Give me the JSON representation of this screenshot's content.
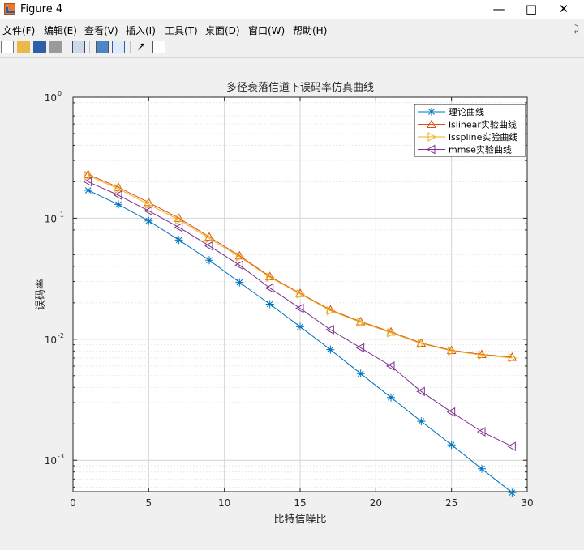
{
  "window": {
    "title": "Figure 4",
    "minimize_icon": "minimize-icon",
    "maximize_icon": "maximize-icon",
    "close_icon": "close-icon"
  },
  "menu": [
    {
      "label": "文件(F)"
    },
    {
      "label": "编辑(E)"
    },
    {
      "label": "查看(V)"
    },
    {
      "label": "插入(I)"
    },
    {
      "label": "工具(T)"
    },
    {
      "label": "桌面(D)"
    },
    {
      "label": "窗口(W)"
    },
    {
      "label": "帮助(H)"
    }
  ],
  "toolbar": {
    "icons": [
      "new-figure-icon",
      "open-file-icon",
      "save-icon",
      "print-icon",
      "link-plot-icon",
      "colorbar-icon",
      "legend-icon",
      "pointer-icon",
      "property-inspector-icon"
    ]
  },
  "chart_data": {
    "type": "line",
    "title": "多径衰落信道下误码率仿真曲线",
    "xlabel": "比特信噪比",
    "ylabel": "误码率",
    "xlim": [
      0,
      30
    ],
    "ylim": [
      0.00055,
      1
    ],
    "yscale": "log",
    "grid": true,
    "legend_position": "top-right",
    "x_ticks": [
      "0",
      "5",
      "10",
      "15",
      "20",
      "25",
      "30"
    ],
    "y_ticks": [
      {
        "base": "10",
        "exp": "0"
      },
      {
        "base": "10",
        "exp": "-1"
      },
      {
        "base": "10",
        "exp": "-2"
      },
      {
        "base": "10",
        "exp": "-3"
      }
    ],
    "x": [
      1,
      3,
      5,
      7,
      9,
      11,
      13,
      15,
      17,
      19,
      21,
      23,
      25,
      27,
      29
    ],
    "series": [
      {
        "name": "理论曲线",
        "color": "#0072bd",
        "marker": "star",
        "values": [
          0.17,
          0.13,
          0.095,
          0.066,
          0.045,
          0.0295,
          0.0195,
          0.0127,
          0.0082,
          0.0052,
          0.0033,
          0.0021,
          0.00134,
          0.00085,
          0.00054
        ]
      },
      {
        "name": "lslinear实验曲线",
        "color": "#d95319",
        "marker": "triangle-up",
        "values": [
          0.23,
          0.18,
          0.135,
          0.1,
          0.07,
          0.049,
          0.033,
          0.024,
          0.0175,
          0.014,
          0.0115,
          0.0093,
          0.0081,
          0.0075,
          0.0071
        ]
      },
      {
        "name": "lsspline实验曲线",
        "color": "#edb120",
        "marker": "triangle-right",
        "values": [
          0.225,
          0.175,
          0.13,
          0.097,
          0.068,
          0.048,
          0.0325,
          0.0237,
          0.0172,
          0.0138,
          0.0113,
          0.0092,
          0.008,
          0.0074,
          0.007
        ]
      },
      {
        "name": "mmse实验曲线",
        "color": "#7e2f8e",
        "marker": "triangle-left",
        "values": [
          0.2,
          0.155,
          0.115,
          0.084,
          0.059,
          0.041,
          0.0265,
          0.018,
          0.012,
          0.0085,
          0.006,
          0.0037,
          0.0025,
          0.00172,
          0.0013
        ]
      }
    ]
  }
}
